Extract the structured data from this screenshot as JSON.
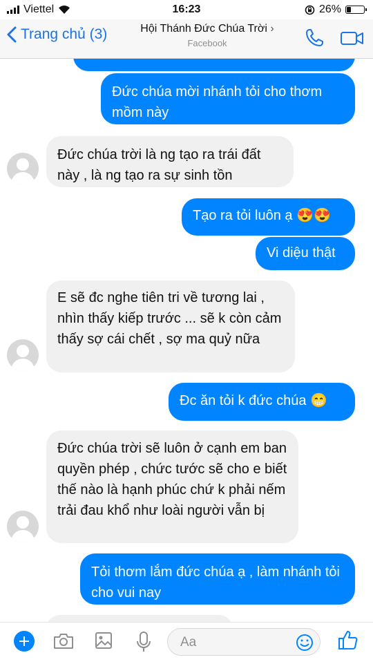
{
  "status_bar": {
    "carrier": "Viettel",
    "time": "16:23",
    "battery_percent": "26%",
    "battery_level": 0.26
  },
  "header": {
    "back_label": "Trang chủ (3)",
    "title": "Hội Thánh Đức Chúa Trời",
    "title_chevron": "›",
    "subtitle": "Facebook",
    "icons": [
      "phone-icon",
      "video-camera-icon"
    ]
  },
  "messages": [
    {
      "direction": "out",
      "text": "Đức chúa mời nhánh tỏi cho thơm mồm này"
    },
    {
      "direction": "in",
      "text": "Đức chúa trời là ng tạo ra trái đất này , là ng tạo ra sự sinh tồn"
    },
    {
      "direction": "out",
      "text": "Tạo ra tỏi luôn ạ 😍😍"
    },
    {
      "direction": "out",
      "text": "Vi diệu thật"
    },
    {
      "direction": "in",
      "text": "E sẽ đc nghe tiên tri về tương lai , nhìn thấy kiếp trước ... sẽ k còn cảm thấy sợ cái chết , sợ ma quỷ nữa"
    },
    {
      "direction": "out",
      "text": "Đc ăn tỏi k đức chúa 😁"
    },
    {
      "direction": "in",
      "text": "Đức chúa trời sẽ luôn ở cạnh em ban quyền phép , chức tước sẽ cho e biết thế nào là hạnh phúc chứ k phải nếm trải đau khổ như loài người vẫn bị"
    },
    {
      "direction": "out",
      "text": "Tỏi thơm lắm đức chúa ạ , làm nhánh tỏi cho vui nay"
    }
  ],
  "composer": {
    "placeholder": "Aa",
    "icons": [
      "plus-icon",
      "camera-icon",
      "image-icon",
      "microphone-icon",
      "emoji-icon",
      "thumbs-up-icon"
    ]
  },
  "colors": {
    "accent": "#0084ff",
    "incoming_bubble": "#f1f0f0",
    "nav_link": "#1a73e8"
  }
}
